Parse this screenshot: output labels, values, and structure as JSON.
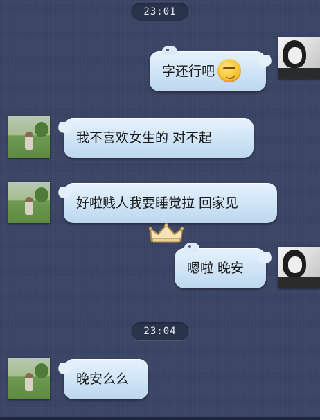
{
  "timestamps": [
    "23:01",
    "23:04"
  ],
  "messages": [
    {
      "side": "right",
      "text": "字还行吧",
      "emoji": "smirk-emoji"
    },
    {
      "side": "left",
      "text": "我不喜欢女生的 对不起"
    },
    {
      "side": "left",
      "text": "好啦贱人我要睡觉拉 回家见"
    },
    {
      "side": "right",
      "text": "嗯啦 晚安"
    },
    {
      "side": "left",
      "text": "晚安么么"
    }
  ],
  "decorations": {
    "crown": "crown-icon"
  },
  "colors": {
    "background": "#3b4565",
    "bubble": "#cfe4f6",
    "timestamp_pill": "#283046",
    "text": "#1a1a1a"
  }
}
